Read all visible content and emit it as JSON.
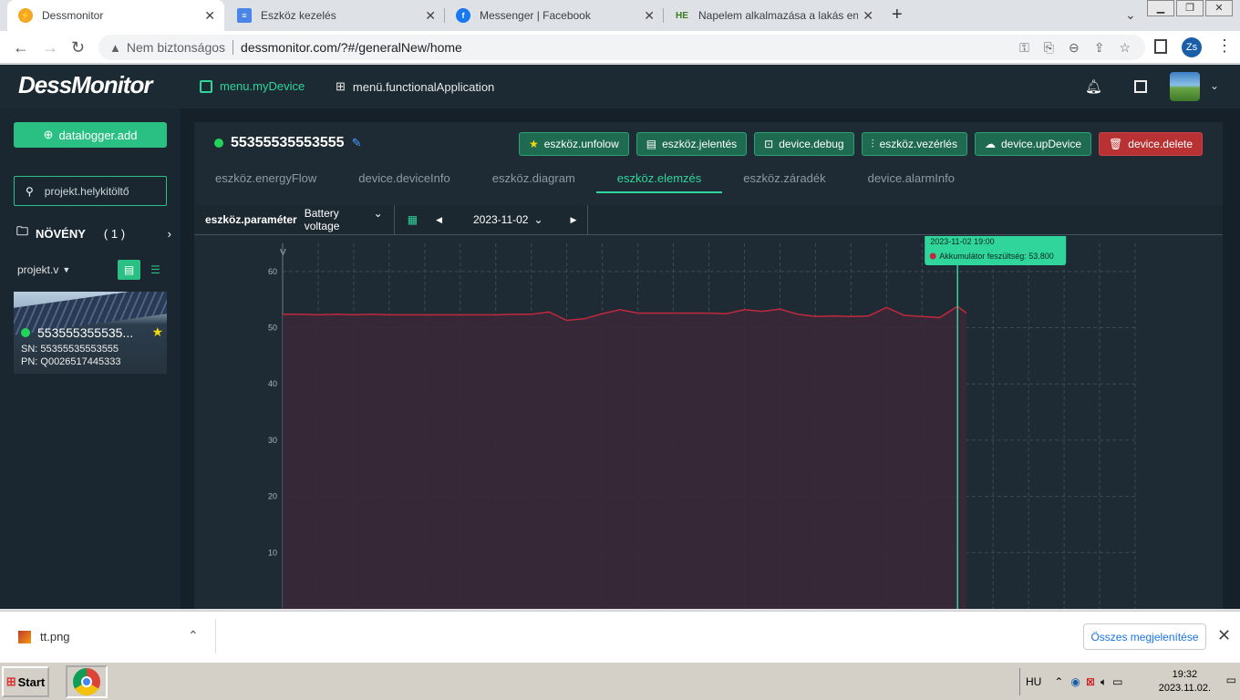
{
  "browser": {
    "tabs": [
      {
        "title": "Dessmonitor",
        "icon": "dessmonitor-favicon",
        "icon_color": "#f5a623",
        "active": true
      },
      {
        "title": "Eszköz kezelés",
        "icon": "document-favicon",
        "icon_color": "#4a86e8",
        "active": false
      },
      {
        "title": "Messenger | Facebook",
        "icon": "facebook-favicon",
        "icon_color": "#1877f2",
        "active": false
      },
      {
        "title": "Napelem alkalmazása a lakás energ",
        "icon": "he-favicon",
        "icon_color": "#3a7d1f",
        "active": false
      }
    ],
    "security_label": "Nem biztonságos",
    "url": "dessmonitor.com/?#/generalNew/home",
    "profile_initials": "Zs"
  },
  "app": {
    "logo": "DessMonitor",
    "nav": {
      "my_device": "menu.myDevice",
      "functional": "menü.functionalApplication"
    },
    "accent": "#2fd59a"
  },
  "sidebar": {
    "add_button": "datalogger.add",
    "search_placeholder": "projekt.helykitöltő",
    "plant_label": "NÖVÉNY",
    "plant_count": "( 1 )",
    "project_select": "projekt.v",
    "device": {
      "name": "553555355535...",
      "sn": "SN: 55355535553555",
      "pn": "PN: Q0026517445333"
    }
  },
  "device": {
    "id": "55355535553555",
    "status_color": "#22d35a",
    "actions": {
      "unfollow": "eszköz.unfolow",
      "report": "eszköz.jelentés",
      "debug": "device.debug",
      "control": "eszköz.vezérlés",
      "update": "device.upDevice",
      "delete": "device.delete"
    },
    "tabs": [
      "eszköz.energyFlow",
      "device.deviceInfo",
      "eszköz.diagram",
      "eszköz.elemzés",
      "eszköz.záradék",
      "device.alarmInfo"
    ],
    "active_tab": 3
  },
  "toolbar": {
    "param_label": "eszköz.paraméter",
    "param_value": "Battery voltage",
    "date": "2023-11-02"
  },
  "chart_data": {
    "type": "area",
    "ylabel": "V",
    "ylim": [
      0,
      65
    ],
    "yticks": [
      10,
      20,
      30,
      40,
      50,
      60
    ],
    "grid": true,
    "series": [
      {
        "name": "Akkumulátor feszültség",
        "color": "#c0283d",
        "fill": "#3a2838",
        "x": [
          0,
          0.5,
          1,
          1.5,
          2,
          2.5,
          3,
          3.5,
          4,
          4.5,
          5,
          5.5,
          6,
          6.5,
          7,
          7.5,
          8,
          8.5,
          9,
          9.5,
          10,
          10.5,
          11,
          11.5,
          12,
          12.5,
          13,
          13.5,
          14,
          14.5,
          15,
          15.5,
          16,
          16.5,
          17,
          17.5,
          18,
          18.5,
          19,
          19.25
        ],
        "values": [
          52.4,
          52.4,
          52.3,
          52.4,
          52.3,
          52.4,
          52.3,
          52.3,
          52.3,
          52.3,
          52.3,
          52.3,
          52.3,
          52.4,
          52.4,
          52.8,
          51.3,
          51.6,
          52.5,
          53.2,
          52.6,
          52.6,
          52.6,
          52.6,
          52.6,
          52.5,
          53.2,
          52.9,
          53.3,
          52.4,
          52.0,
          52.1,
          52.0,
          52.1,
          53.6,
          52.2,
          52.0,
          51.8,
          53.8,
          52.6
        ]
      }
    ],
    "tooltip": {
      "time": "2023-11-02 19:00",
      "label": "Akkumulátor feszültség: 53.800",
      "color": "#2fd59a"
    }
  },
  "downloads": {
    "file": "tt.png",
    "show_all": "Összes megjelenítése"
  },
  "taskbar": {
    "start": "Start",
    "lang": "HU",
    "time": "19:32",
    "date": "2023.11.02."
  }
}
